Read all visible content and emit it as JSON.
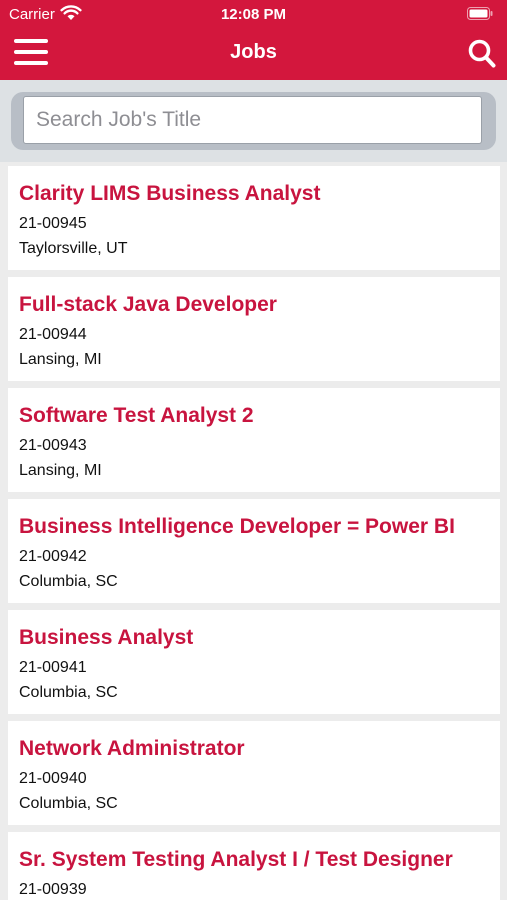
{
  "status_bar": {
    "carrier": "Carrier",
    "time": "12:08 PM"
  },
  "header": {
    "title": "Jobs"
  },
  "search": {
    "placeholder": "Search Job's Title",
    "value": ""
  },
  "jobs": [
    {
      "title": "Clarity LIMS Business Analyst",
      "id": "21-00945",
      "location": "Taylorsville, UT"
    },
    {
      "title": "Full-stack Java Developer",
      "id": "21-00944",
      "location": "Lansing, MI"
    },
    {
      "title": "Software Test Analyst 2",
      "id": "21-00943",
      "location": "Lansing, MI"
    },
    {
      "title": "Business Intelligence Developer = Power BI",
      "id": "21-00942",
      "location": "Columbia, SC"
    },
    {
      "title": "Business Analyst",
      "id": "21-00941",
      "location": "Columbia, SC"
    },
    {
      "title": "Network Administrator",
      "id": "21-00940",
      "location": "Columbia, SC"
    },
    {
      "title": "Sr. System Testing Analyst I / Test Designer",
      "id": "21-00939",
      "location": ""
    }
  ],
  "colors": {
    "brand": "#d3173d",
    "title_text": "#c8143f",
    "background": "#ececec"
  },
  "icons": {
    "menu": "hamburger-menu-icon",
    "search": "search-icon",
    "wifi": "wifi-icon",
    "battery": "battery-icon"
  }
}
